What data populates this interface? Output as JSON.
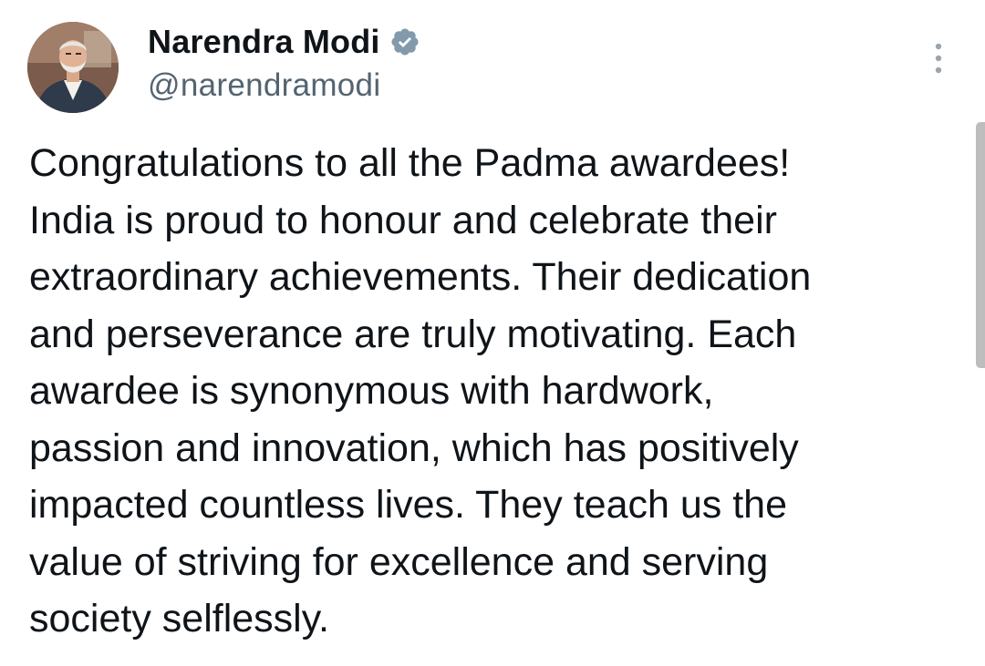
{
  "author": {
    "name": "Narendra Modi",
    "handle": "@narendramodi",
    "verified": true,
    "verified_badge_color": "#829aab"
  },
  "icons": {
    "avatar": "profile-photo",
    "verified": "verified-badge-icon",
    "more": "more-vertical-icon"
  },
  "tweet": {
    "lines": [
      "Congratulations to all the Padma awardees!",
      "India is proud to honour and celebrate their",
      "extraordinary achievements. Their dedication",
      "and perseverance are truly motivating. Each",
      "awardee is synonymous with hardwork,",
      "passion and innovation, which has positively",
      "impacted countless lives. They teach us the",
      "value of striving for excellence and serving",
      "society selflessly."
    ]
  },
  "colors": {
    "text_primary": "#0f1419",
    "text_secondary": "#536471",
    "background": "#ffffff",
    "scrollbar": "#bdbdbd"
  }
}
